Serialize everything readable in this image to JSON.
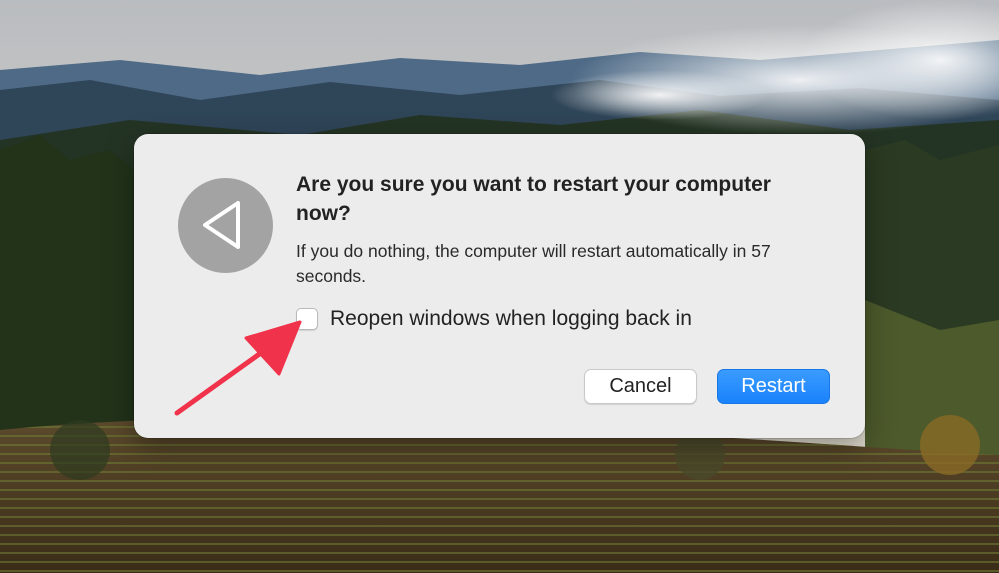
{
  "dialog": {
    "title": "Are you sure you want to restart your computer now?",
    "message": "If you do nothing, the computer will restart automatically in 57 seconds.",
    "checkbox": {
      "label": "Reopen windows when logging back in",
      "checked": false
    },
    "buttons": {
      "cancel_label": "Cancel",
      "restart_label": "Restart"
    },
    "icon": "restart-triangle-icon"
  },
  "annotation": {
    "icon": "red-arrow-icon",
    "color": "#f0324a"
  },
  "colors": {
    "accent": "#1a82fb",
    "dialog_background": "#ececec"
  }
}
